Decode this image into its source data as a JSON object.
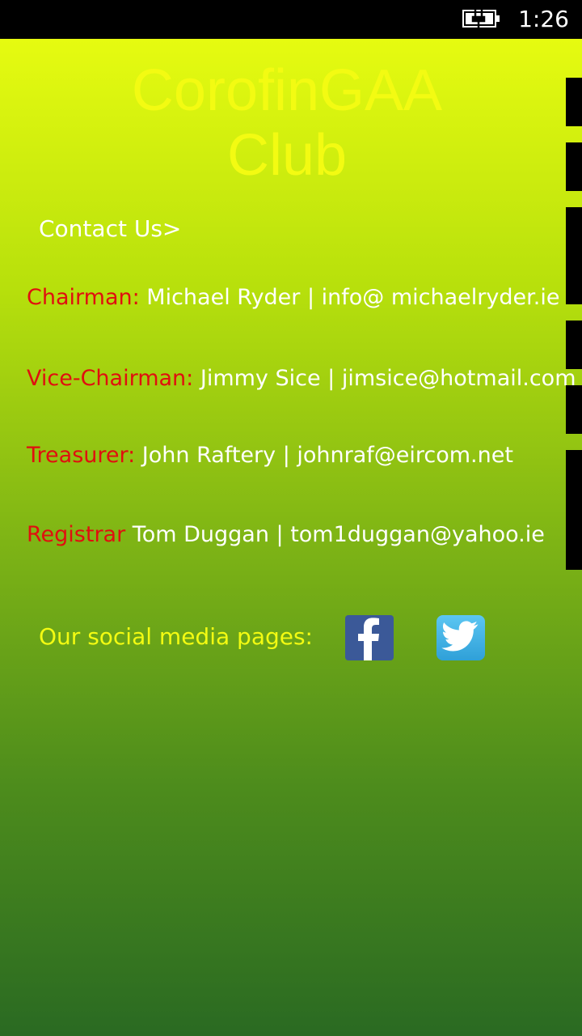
{
  "status": {
    "time": "1:26"
  },
  "title": "CorofinGAA Club",
  "contact_link": "Contact Us>",
  "contacts": [
    {
      "role": "Chairman:",
      "details": " Michael Ryder | info@ michaelryder.ie"
    },
    {
      "role": "Vice-Chairman:",
      "details": " Jimmy Sice | jimsice@hotmail.com"
    },
    {
      "role": "Treasurer:",
      "details": " John Raftery | johnraf@eircom.net"
    },
    {
      "role": "Registrar",
      "details": "  Tom Duggan | tom1duggan@yahoo.ie"
    }
  ],
  "social": {
    "label": "Our social media pages:",
    "icons": [
      "facebook-icon",
      "twitter-icon"
    ]
  },
  "colors": {
    "role": "#e00f0f",
    "title": "#f3fb12",
    "accent_text": "#f3fb12"
  }
}
